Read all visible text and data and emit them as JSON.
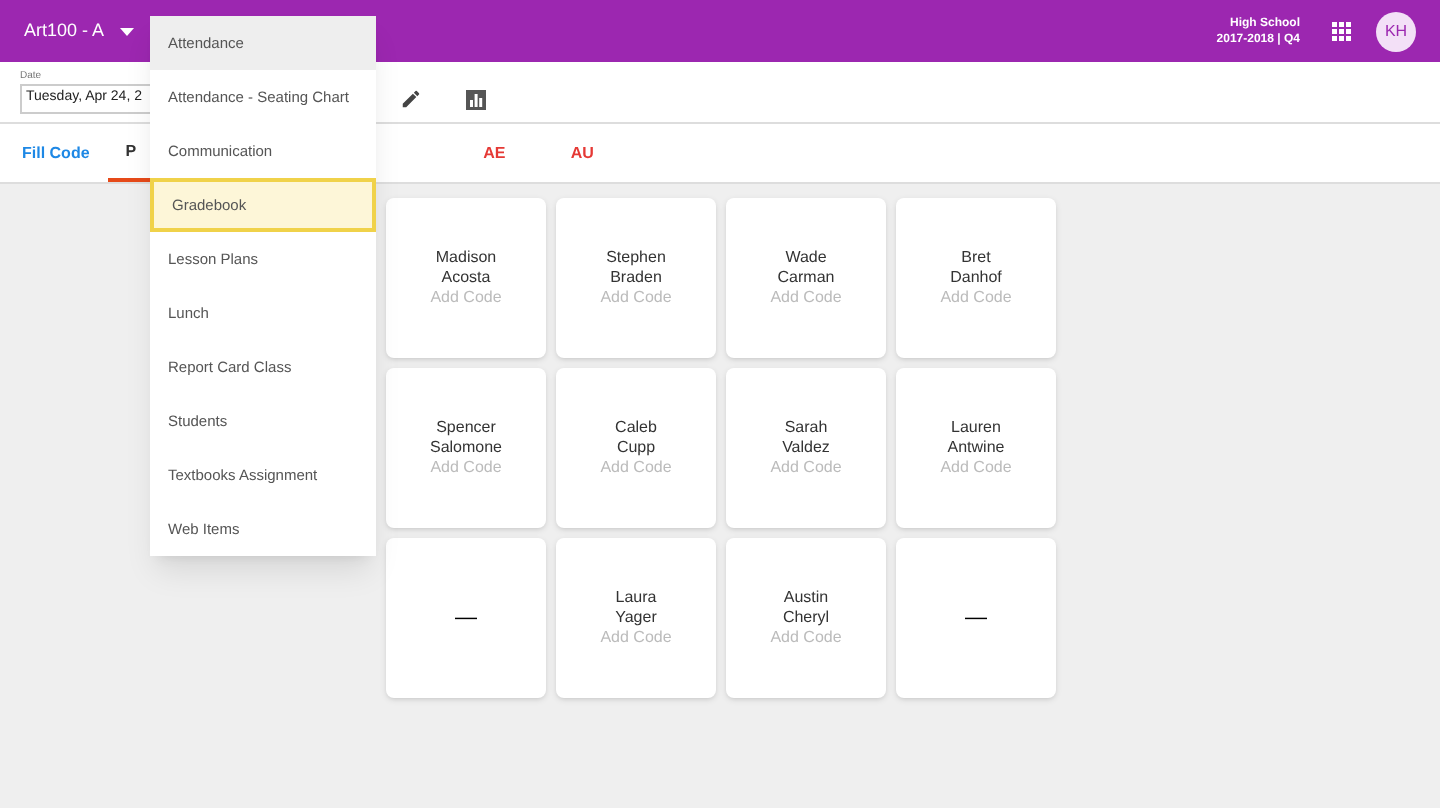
{
  "header": {
    "class_name": "Art100 - A",
    "school": "High School",
    "term": "2017-2018 | Q4",
    "avatar": "KH"
  },
  "date_field": {
    "label": "Date",
    "value": "Tuesday, Apr 24, 2"
  },
  "tabs": [
    {
      "label": "Fill Code",
      "kind": "action",
      "selected": false
    },
    {
      "label": "P",
      "kind": "code",
      "selected": true
    },
    {
      "label": "AE",
      "kind": "absence",
      "selected": false
    },
    {
      "label": "AU",
      "kind": "absence",
      "selected": false
    }
  ],
  "menu": [
    {
      "label": "Attendance",
      "active": true,
      "selected": false
    },
    {
      "label": "Attendance - Seating Chart",
      "active": false,
      "selected": false
    },
    {
      "label": "Communication",
      "active": false,
      "selected": false
    },
    {
      "label": "Gradebook",
      "active": false,
      "selected": true
    },
    {
      "label": "Lesson Plans",
      "active": false,
      "selected": false
    },
    {
      "label": "Lunch",
      "active": false,
      "selected": false
    },
    {
      "label": "Report Card Class",
      "active": false,
      "selected": false
    },
    {
      "label": "Students",
      "active": false,
      "selected": false
    },
    {
      "label": "Textbooks Assignment",
      "active": false,
      "selected": false
    },
    {
      "label": "Web Items",
      "active": false,
      "selected": false
    }
  ],
  "seats": [
    {
      "kind": "student",
      "first": "Madison",
      "last": "Acosta",
      "code": "Add Code"
    },
    {
      "kind": "student",
      "first": "Stephen",
      "last": "Braden",
      "code": "Add Code"
    },
    {
      "kind": "student",
      "first": "Wade",
      "last": "Carman",
      "code": "Add Code"
    },
    {
      "kind": "student",
      "first": "Bret",
      "last": "Danhof",
      "code": "Add Code"
    },
    {
      "kind": "student",
      "first": "Spencer",
      "last": "Salomone",
      "code": "Add Code"
    },
    {
      "kind": "student",
      "first": "Caleb",
      "last": "Cupp",
      "code": "Add Code"
    },
    {
      "kind": "student",
      "first": "Sarah",
      "last": "Valdez",
      "code": "Add Code"
    },
    {
      "kind": "student",
      "first": "Lauren",
      "last": "Antwine",
      "code": "Add Code"
    },
    {
      "kind": "empty",
      "mark": "—"
    },
    {
      "kind": "student",
      "first": "Laura",
      "last": "Yager",
      "code": "Add Code"
    },
    {
      "kind": "student",
      "first": "Austin",
      "last": "Cheryl",
      "code": "Add Code"
    },
    {
      "kind": "empty",
      "mark": "—"
    }
  ]
}
